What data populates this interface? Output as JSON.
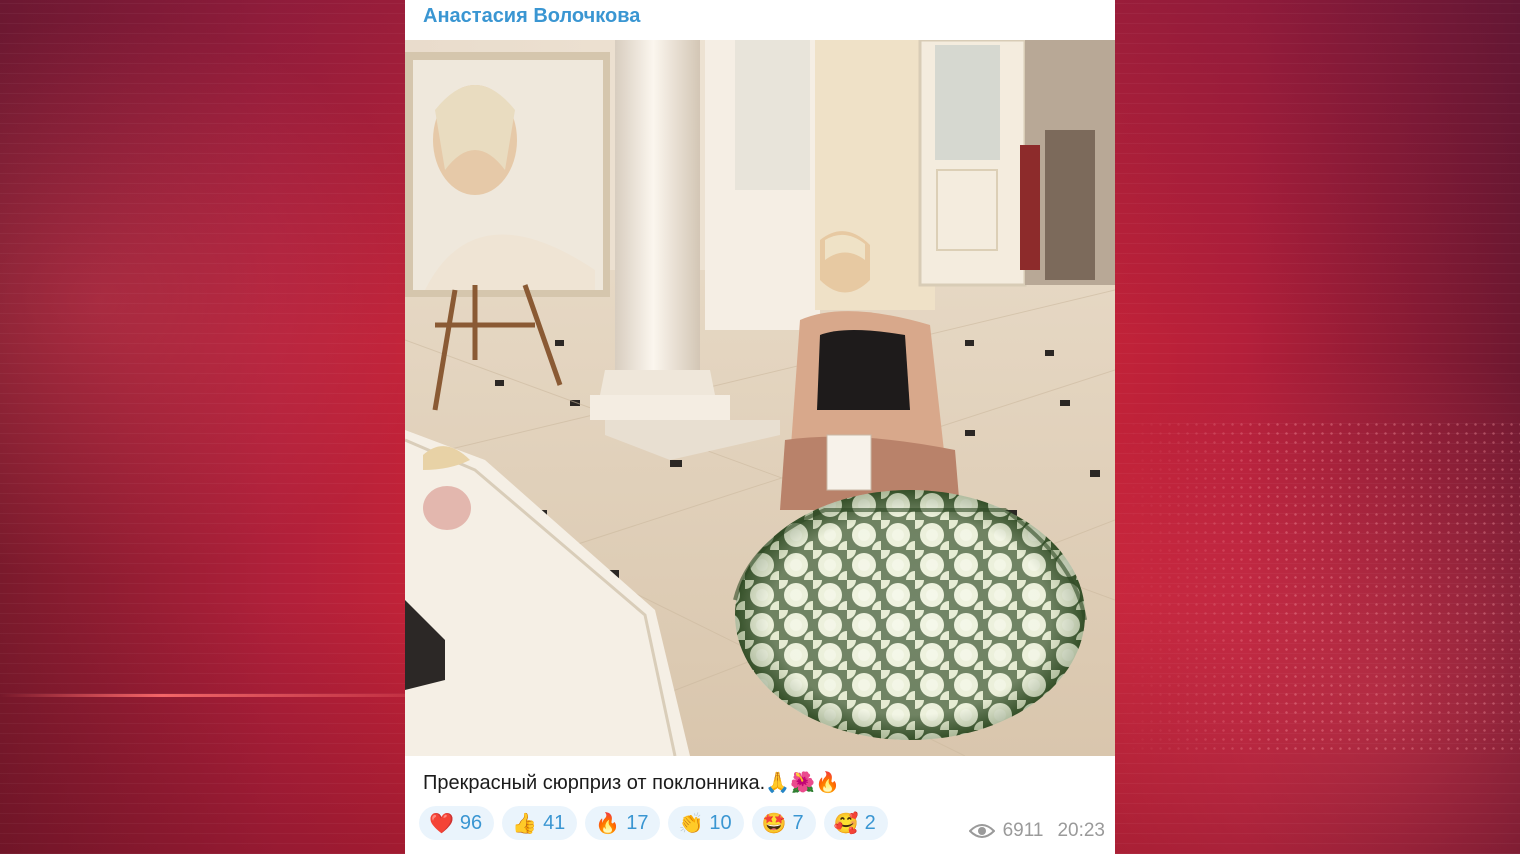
{
  "post": {
    "channel_name": "Анастасия Волочкова",
    "caption": "Прекрасный сюрприз от поклонника.🙏🌺🔥",
    "views": "6911",
    "time": "20:23"
  },
  "reactions": [
    {
      "icon": "red-heart-icon",
      "emoji": "❤️",
      "count": "96"
    },
    {
      "icon": "thumbs-up-icon",
      "emoji": "👍",
      "count": "41"
    },
    {
      "icon": "fire-icon",
      "emoji": "🔥",
      "count": "17"
    },
    {
      "icon": "clapping-hands-icon",
      "emoji": "👏",
      "count": "10"
    },
    {
      "icon": "star-struck-icon",
      "emoji": "🤩",
      "count": "7"
    },
    {
      "icon": "party-face-icon",
      "emoji": "🥰",
      "count": "2"
    }
  ],
  "colors": {
    "accent": "#3a96d2",
    "reaction_bg": "#eaf4fc",
    "background_red": "#c72338"
  }
}
